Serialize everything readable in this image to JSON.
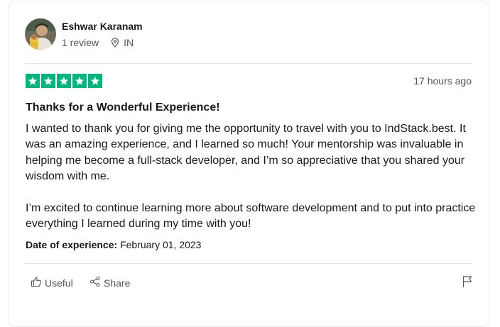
{
  "reviewer": {
    "name": "Eshwar Karanam",
    "review_count": "1 review",
    "country": "IN",
    "avatar_icon": "user-photo-avatar"
  },
  "review": {
    "rating": 5,
    "rating_max": 5,
    "star_color": "#00b67a",
    "posted": "17 hours ago",
    "title": "Thanks for a Wonderful Experience!",
    "paragraphs": [
      "I wanted to thank you for giving me the opportunity to travel with you to IndStack.best. It was an amazing experience, and I learned so much! Your mentorship was invaluable in helping me become a full-stack developer, and I’m so appreciative that you shared your wisdom with me.",
      "I’m excited to continue learning more about software development and to put into practice everything I learned during my time with you!"
    ],
    "experience_label": "Date of experience:",
    "experience_date": "February 01, 2023"
  },
  "actions": {
    "useful_label": "Useful",
    "share_label": "Share",
    "useful_icon": "thumbs-up-icon",
    "share_icon": "share-icon",
    "report_icon": "flag-icon"
  }
}
